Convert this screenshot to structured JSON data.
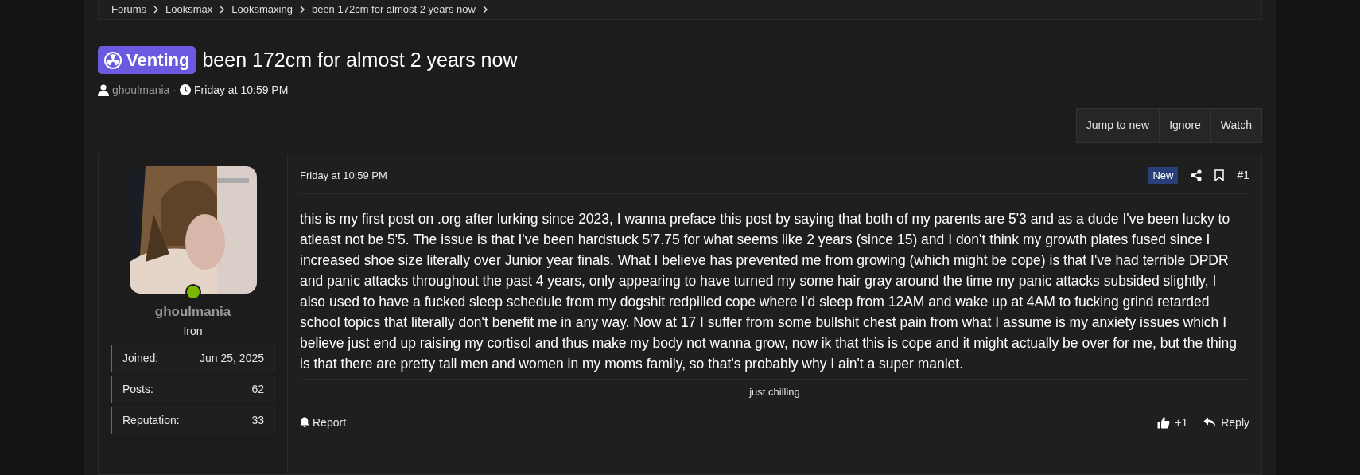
{
  "breadcrumbs": [
    "Forums",
    "Looksmax",
    "Looksmaxing",
    "been 172cm for almost 2 years now"
  ],
  "thread": {
    "prefix": "Venting",
    "title": "been 172cm for almost 2 years now",
    "author": "ghoulmania",
    "separator": "·",
    "date": "Friday at 10:59 PM"
  },
  "thread_buttons": [
    "Jump to new",
    "Ignore",
    "Watch"
  ],
  "post": {
    "user": {
      "name": "ghoulmania",
      "online": true,
      "rank": "Iron",
      "stats": [
        {
          "label": "Joined:",
          "value": "Jun 25, 2025"
        },
        {
          "label": "Posts:",
          "value": "62"
        },
        {
          "label": "Reputation:",
          "value": "33"
        }
      ]
    },
    "date": "Friday at 10:59 PM",
    "new_badge": "New",
    "number": "#1",
    "body": "this is my first post on .org after lurking since 2023, I wanna preface this post by saying that both of my parents are 5'3 and as a dude I've been lucky to atleast not be 5'5. The issue is that I've been hardstuck 5'7.75 for what seems like 2 years (since 15) and I don't think my growth plates fused since I increased shoe size literally over Junior year finals. What I believe has prevented me from growing (which might be cope) is that I've had terrible DPDR and panic attacks throughout the past 4 years, only appearing to have turned my some hair gray around the time my panic attacks subsided slightly, I also used to have a fucked sleep schedule from my dogshit redpilled cope where I'd sleep from 12AM and wake up at 4AM to fucking grind retarded school topics that literally don't benefit me in any way. Now at 17 I suffer from some bullshit chest pain from what I assume is my anxiety issues which I believe just end up raising my cortisol and thus make my body not wanna grow, now ik that this is cope and it might actually be over for me, but the thing is that there are pretty tall men and women in my moms family, so that's probably why I ain't a super manlet.",
    "signature": "just chilling",
    "report": "Report",
    "reactions": "+1",
    "reply": "Reply"
  }
}
